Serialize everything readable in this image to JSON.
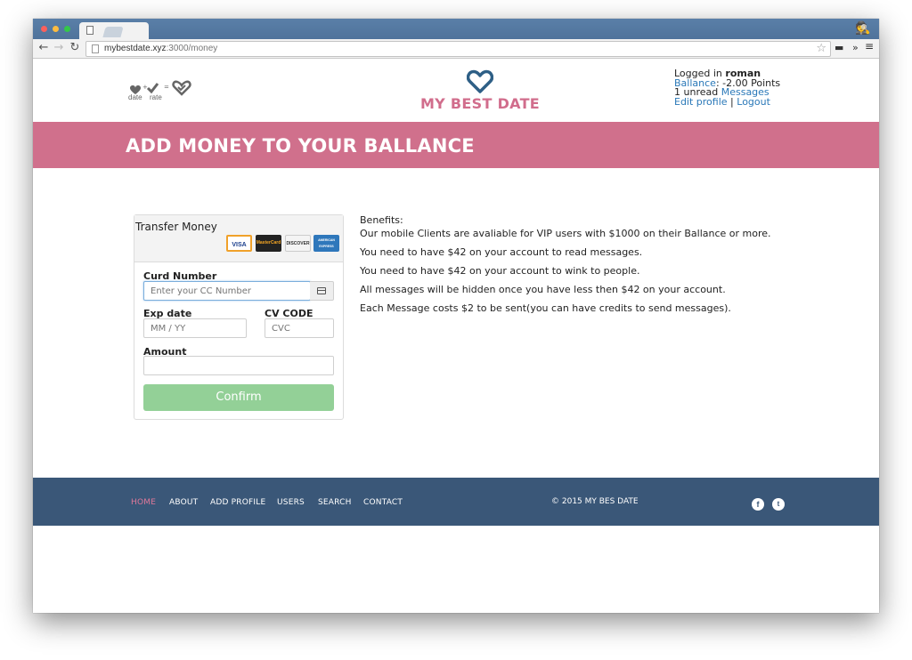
{
  "browser": {
    "url_host": "mybestdate.xyz",
    "url_path": ":3000/money"
  },
  "header": {
    "mini_logo": {
      "date": "date",
      "rate": "rate",
      "plus": "+",
      "equals": "="
    },
    "brand_name": "MY BEST DATE",
    "user": {
      "logged_in_prefix": "Logged in",
      "username": "roman",
      "balance_link": "Ballance",
      "balance_value": ": -2.00 Points",
      "unread_prefix": "1 unread",
      "messages_link": "Messages",
      "edit_profile_link": "Edit profile",
      "separator": "|",
      "logout_link": "Logout"
    }
  },
  "banner": {
    "title": "ADD MONEY TO YOUR BALLANCE"
  },
  "payment_form": {
    "title": "Transfer Money",
    "cards": [
      "VISA",
      "MasterCard",
      "DISCOVER",
      "AMERICAN EXPRESS"
    ],
    "card_number_label": "Curd Number",
    "card_number_placeholder": "Enter your CC Number",
    "exp_label": "Exp date",
    "exp_placeholder": "MM / YY",
    "cvc_label": "CV CODE",
    "cvc_placeholder": "CVC",
    "amount_label": "Amount",
    "amount_value": "",
    "confirm_label": "Confirm",
    "confirm_color": "#93d097"
  },
  "benefits": {
    "heading": "Benefits:",
    "lines": [
      "Our mobile Clients are avaliable for VIP users with $1000 on their Ballance or more.",
      "You need to have $42 on your account to read messages.",
      "You need to have $42 on your account to wink to people.",
      "All messages will be hidden once you have less then $42 on your account.",
      "Each Message costs $2 to be sent(you can have credits to send messages)."
    ]
  },
  "footer": {
    "nav": [
      "HOME",
      "ABOUT",
      "ADD PROFILE",
      "USERS",
      "SEARCH",
      "CONTACT"
    ],
    "active": "HOME",
    "copyright": "© 2015 MY BES DATE",
    "social": [
      "facebook-icon",
      "twitter-icon"
    ],
    "background": "#3a5778"
  },
  "colors": {
    "brand_pink": "#d0708c",
    "link_blue": "#2a78b8",
    "brand_heart": "#2e5f86"
  }
}
